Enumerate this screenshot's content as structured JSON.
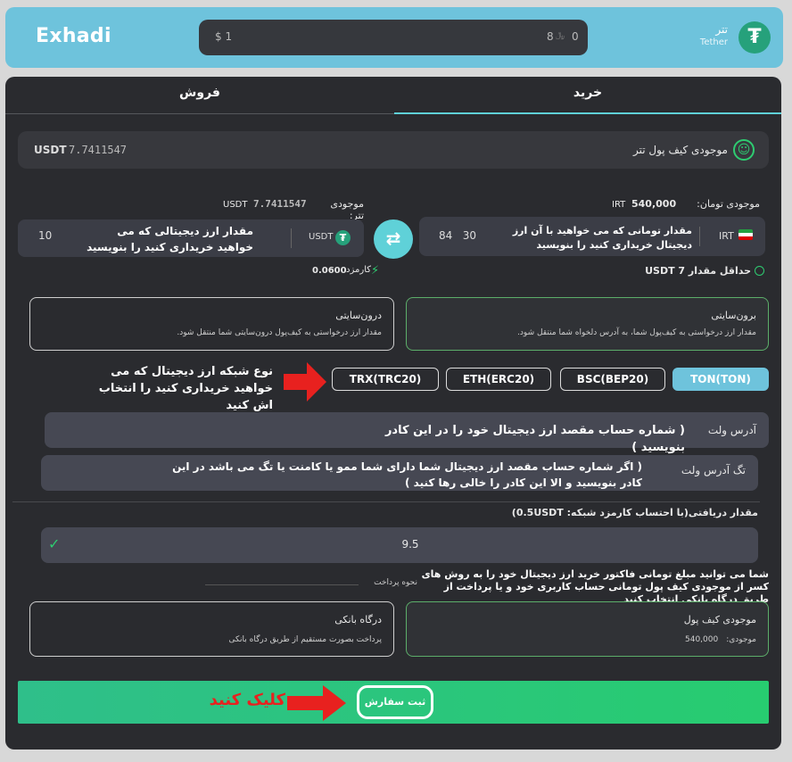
{
  "header": {
    "logo": "Exhadi",
    "coin_name": "تتر",
    "coin_sub": "Tether",
    "search_left": "$ 1",
    "search_mid": "8",
    "search_mid_unit": "﷼",
    "search_right": "0",
    "coin_icon": "tether-icon"
  },
  "tabs": {
    "buy": "خرید",
    "sell": "فروش"
  },
  "wallet": {
    "label": "موجودی کیف پول تتر",
    "value": "7.7411547",
    "currency": "USDT"
  },
  "toman_balance": {
    "label": "موجودی تومان:",
    "value": "540,000",
    "unit": "IRT"
  },
  "tether_balance": {
    "label": "موجودی تتر:",
    "value": "7.7411547",
    "unit": "USDT"
  },
  "pay_input": {
    "currency": "IRT",
    "value": "84   30",
    "note": "مقدار تومانی که می خواهید با آن ارز دیجیتال خریداری کنید را بنویسید"
  },
  "receive_input": {
    "currency": "USDT",
    "value": "10",
    "note": "مقدار ارز دیجیتالی که می خواهید خریداری کنید را بنویسید"
  },
  "min_amount": {
    "label": "حداقل مقدار USDT 7"
  },
  "fee": {
    "label": "کارمزد",
    "value": "0.0600"
  },
  "options": {
    "external": {
      "title": "برون‌سایتی",
      "desc": "مقدار ارز درخواستی به کیف‌پول شما، به آدرس دلخواه شما منتقل شود."
    },
    "internal": {
      "title": "درون‌سایتی",
      "desc": "مقدار ارز درخواستی به کیف‌پول درون‌سایتی شما منتقل شود."
    }
  },
  "networks": {
    "ton": "TON(TON)",
    "bsc": "BSC(BEP20)",
    "eth": "ETH(ERC20)",
    "trx": "TRX(TRC20)"
  },
  "network_note": "نوع شبکه ارز دیجیتال که می خواهید خریداری کنید را انتخاب اش کنید",
  "wallet_address": {
    "label": "آدرس ولت",
    "note": "( شماره حساب مقصد ارز دیجیتال خود را در این کادر بنویسید )"
  },
  "tag_address": {
    "label": "تگ آدرس ولت",
    "note": "( اگر شماره حساب مقصد ارز دیجیتال شما دارای شما ممو یا کامنت یا تگ می باشد در این کادر بنویسید و الا این کادر را خالی رها کنید )"
  },
  "received": {
    "label": "مقدار دریافتی(با احتساب کارمزد شبکه: 0.5USDT)",
    "value": "9.5"
  },
  "payment_note": "شما می توانید مبلغ تومانی فاکتور خرید ارز دیجیتال خود را به روش های کسر از موجودی کیف پول تومانی حساب کاربری خود و یا پرداخت از طریق درگاه بانکی انتخاب کنید",
  "payment_method_label": "نحوه پرداخت",
  "pay_wallet": {
    "title": "موجودی کیف پول",
    "sub_label": "موجودی:",
    "sub_value": "540,000"
  },
  "pay_gateway": {
    "title": "درگاه بانکی",
    "desc": "پرداخت بصورت مستقیم از طریق درگاه بانکی"
  },
  "submit": {
    "label": "ثبت سفارش",
    "click_note": "کلیک کنید"
  },
  "colors": {
    "accent": "#5fd1d8",
    "green": "#2ecc71",
    "border_green": "#5cae6a",
    "topbar": "#6ec3dc",
    "red": "#e8211f"
  }
}
